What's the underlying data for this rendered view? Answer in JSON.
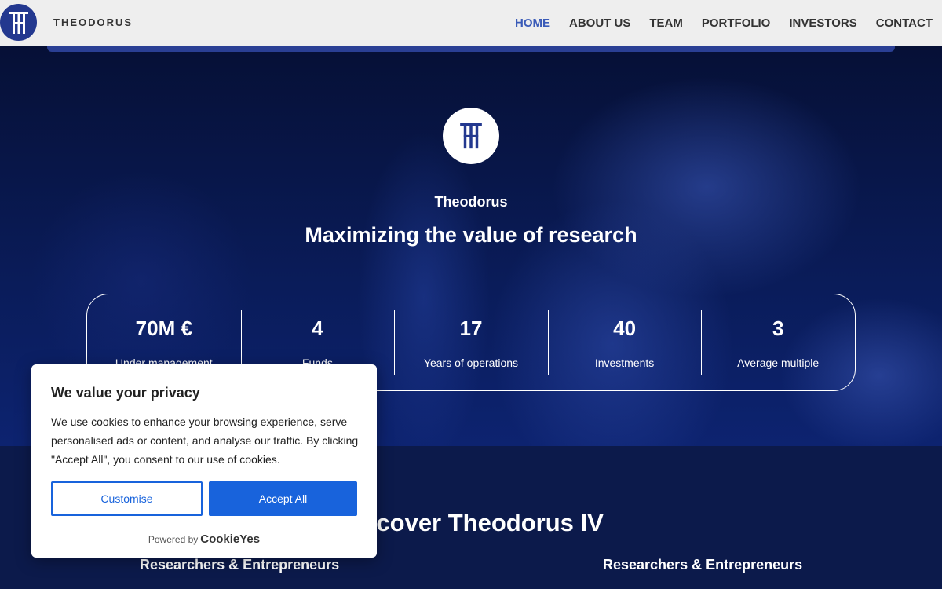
{
  "header": {
    "brand": "THEODORUS",
    "nav": [
      {
        "label": "HOME",
        "active": true
      },
      {
        "label": "ABOUT US",
        "active": false
      },
      {
        "label": "TEAM",
        "active": false
      },
      {
        "label": "PORTFOLIO",
        "active": false
      },
      {
        "label": "INVESTORS",
        "active": false
      },
      {
        "label": "CONTACT",
        "active": false
      }
    ]
  },
  "hero": {
    "name": "Theodorus",
    "tagline": "Maximizing the value of research",
    "stats": [
      {
        "value": "70M €",
        "label": "Under management"
      },
      {
        "value": "4",
        "label": "Funds"
      },
      {
        "value": "17",
        "label": "Years of operations"
      },
      {
        "value": "40",
        "label": "Investments"
      },
      {
        "value": "3",
        "label": "Average multiple"
      }
    ]
  },
  "lower": {
    "discover_prefix": "Discover",
    "discover_name": "Theodorus IV",
    "sub_left": "Researchers & Entrepreneurs",
    "sub_right": "Researchers & Entrepreneurs"
  },
  "cookie": {
    "title": "We value your privacy",
    "text": "We use cookies to enhance your browsing experience, serve personalised ads or content, and analyse our traffic. By clicking \"Accept All\", you consent to our use of cookies.",
    "customise": "Customise",
    "accept": "Accept All",
    "powered_by": "Powered by",
    "powered_brand": "CookieYes"
  },
  "colors": {
    "brand_blue": "#23388f",
    "nav_active": "#3a5bb8",
    "cookie_button": "#1863dc"
  }
}
